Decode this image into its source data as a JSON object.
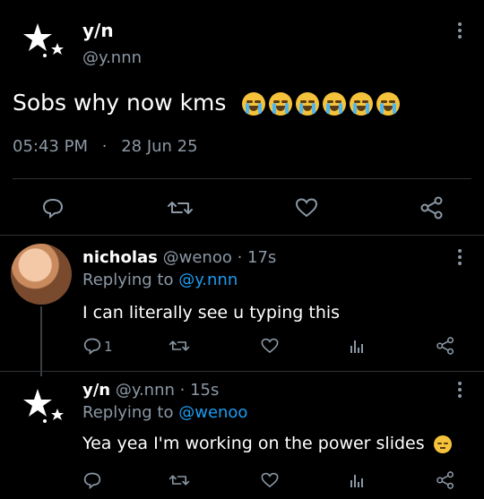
{
  "main_tweet": {
    "name": "y/n",
    "handle": "@y.nnn",
    "text": "Sobs why now kms",
    "emoji_count": 6,
    "time": "05:43 PM",
    "separator": "·",
    "date": "28 Jun 25"
  },
  "replies": [
    {
      "name": "nicholas",
      "handle": "@wenoo",
      "age": "· 17s",
      "replying_prefix": "Replying to",
      "replying_to": "@y.nnn",
      "text": "I can literally see u typing this",
      "reply_count": "1"
    },
    {
      "name": "y/n",
      "handle": "@y.nnn",
      "age": "· 15s",
      "replying_prefix": "Replying to",
      "replying_to": "@wenoo",
      "text": "Yea yea I'm working on the power slides"
    }
  ],
  "colors": {
    "background": "#000000",
    "muted": "#8b98a5",
    "link": "#1d9bf0"
  }
}
